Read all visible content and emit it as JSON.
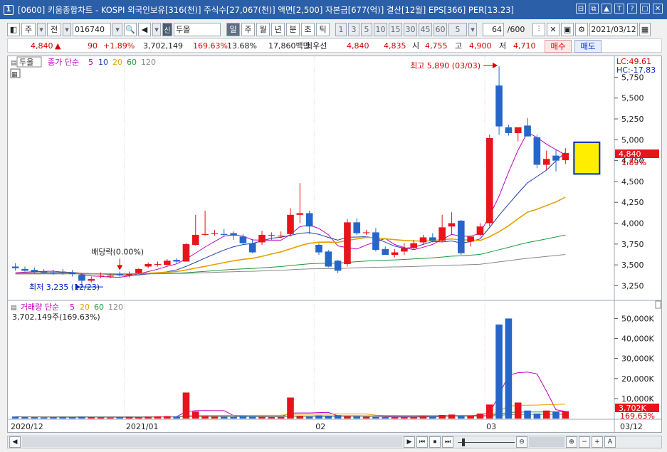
{
  "window": {
    "title": "[0600] 키움종합차트 - KOSPI 외국인보유[316(천)] 주식수[27,067(천)] 액면[2,500] 자본금[677(억)] 결산[12월] EPS[366] PER[13.23]",
    "badge": "1",
    "controls": [
      "⊟",
      "⧉",
      "▲",
      "T",
      "?",
      "▢",
      "✕"
    ]
  },
  "toolbar": {
    "period_type": "주",
    "market_btn": "전",
    "code": "016740",
    "stock_mark": "신",
    "stock_name": "두올",
    "periods": [
      "일",
      "주",
      "월",
      "년",
      "분",
      "초",
      "틱"
    ],
    "active_period": "일",
    "minute_options": [
      "1",
      "3",
      "5",
      "10",
      "15",
      "30",
      "45",
      "60"
    ],
    "tick_value": "5",
    "count": "64",
    "count_total": "/600",
    "date": "2021/03/12"
  },
  "quote": {
    "price": "4,840",
    "arrow": "▲",
    "change": "90",
    "change_pct": "+1.89%",
    "volume": "3,702,149",
    "volume_ratio": "169.63%",
    "turnover": "13.68%",
    "amount": "17,860백만",
    "best_bid_label": "최우선",
    "best_ask": "4,840",
    "best_bid": "4,835",
    "open_label": "시",
    "open": "4,755",
    "high_label": "고",
    "high": "4,900",
    "low_label": "저",
    "low": "4,710",
    "buy_label": "매수",
    "sell_label": "매도"
  },
  "price_panel": {
    "stock_label": "두올",
    "legend_prefix": "종가 단순",
    "ma": [
      {
        "label": "5",
        "color": "#c000c0"
      },
      {
        "label": "10",
        "color": "#1f3ea6"
      },
      {
        "label": "20",
        "color": "#e3a100"
      },
      {
        "label": "60",
        "color": "#1e9a3a"
      },
      {
        "label": "120",
        "color": "#888888"
      }
    ],
    "lc": "LC:49.61",
    "hc": "HC:-17.83",
    "y_ticks": [
      "5,750",
      "5,500",
      "5,250",
      "5,000",
      "4,750",
      "4,500",
      "4,250",
      "4,000",
      "3,750",
      "3,500",
      "3,250"
    ],
    "current_price_tag": "4,840",
    "current_pct_tag": "1.89%",
    "high_annotation": "최고 5,890 (03/03)",
    "low_annotation": "최저 3,235 (12/23)",
    "dividend_annotation": "배당락(0.00%)"
  },
  "volume_panel": {
    "legend_prefix": "거래량 단순",
    "ma": [
      {
        "label": "5",
        "color": "#c000c0"
      },
      {
        "label": "20",
        "color": "#e3a100"
      },
      {
        "label": "60",
        "color": "#1e9a3a"
      },
      {
        "label": "120",
        "color": "#888888"
      }
    ],
    "current_volume_text": "3,702,149주(169.63%)",
    "y_ticks": [
      "50,000K",
      "40,000K",
      "30,000K",
      "20,000K",
      "10,000K"
    ],
    "current_volume_tag": "3,702K",
    "current_volume_pct_tag": "169.63%"
  },
  "x_axis": {
    "labels": [
      "2020/12",
      "2021/01",
      "02",
      "03"
    ],
    "cursor_date": "03/12"
  },
  "scroll": {
    "buttons": [
      "◀",
      "▶",
      "⏮",
      "⏹",
      "⏭",
      "⊖",
      "⊕",
      "−",
      "+",
      "A"
    ]
  },
  "colors": {
    "up_candle": "#e8141b",
    "down_candle": "#2566c8",
    "title_bar": "#2b5fa7",
    "highlight_box": "#ffee00"
  },
  "chart_data": {
    "type": "candlestick",
    "dates": [
      "12/14",
      "12/15",
      "12/16",
      "12/17",
      "12/18",
      "12/21",
      "12/22",
      "12/23",
      "12/24",
      "12/28",
      "12/29",
      "12/30",
      "01/04",
      "01/05",
      "01/06",
      "01/07",
      "01/08",
      "01/11",
      "01/12",
      "01/13",
      "01/14",
      "01/15",
      "01/18",
      "01/19",
      "01/20",
      "01/21",
      "01/22",
      "01/25",
      "01/26",
      "01/27",
      "01/28",
      "01/29",
      "02/01",
      "02/02",
      "02/03",
      "02/04",
      "02/05",
      "02/08",
      "02/09",
      "02/10",
      "02/15",
      "02/16",
      "02/17",
      "02/18",
      "02/19",
      "02/22",
      "02/23",
      "02/24",
      "02/25",
      "02/26",
      "03/02",
      "03/03",
      "03/04",
      "03/05",
      "03/08",
      "03/09",
      "03/10",
      "03/11",
      "03/12"
    ],
    "open": [
      3480,
      3450,
      3440,
      3420,
      3410,
      3420,
      3410,
      3380,
      3310,
      3370,
      3360,
      3390,
      3380,
      3400,
      3480,
      3510,
      3500,
      3560,
      3540,
      3740,
      3860,
      3870,
      3870,
      3880,
      3840,
      3760,
      3770,
      3860,
      3840,
      3870,
      4100,
      4120,
      3740,
      3660,
      3550,
      3510,
      4010,
      3880,
      3890,
      3690,
      3620,
      3660,
      3700,
      3770,
      3830,
      3790,
      3960,
      4030,
      3780,
      3860,
      4000,
      5650,
      5150,
      5080,
      5170,
      5030,
      4700,
      4810,
      4755
    ],
    "high": [
      3520,
      3480,
      3470,
      3450,
      3440,
      3450,
      3440,
      3400,
      3360,
      3410,
      3400,
      3420,
      3420,
      3460,
      3530,
      3540,
      3570,
      3580,
      3760,
      4100,
      4150,
      3920,
      3930,
      3900,
      3870,
      3810,
      3910,
      3890,
      3900,
      4180,
      4480,
      4150,
      3760,
      3680,
      3560,
      4050,
      4060,
      3920,
      3940,
      3720,
      3690,
      3760,
      3800,
      3860,
      3880,
      4100,
      4130,
      4040,
      3800,
      4000,
      5060,
      5880,
      5180,
      5100,
      5260,
      5060,
      4870,
      4880,
      4900
    ],
    "low": [
      3430,
      3420,
      3400,
      3390,
      3380,
      3380,
      3360,
      3235,
      3290,
      3340,
      3340,
      3360,
      3350,
      3390,
      3460,
      3480,
      3490,
      3520,
      3540,
      3730,
      3850,
      3850,
      3840,
      3800,
      3740,
      3640,
      3740,
      3800,
      3820,
      3840,
      4000,
      3870,
      3620,
      3470,
      3400,
      3480,
      3860,
      3860,
      3660,
      3640,
      3590,
      3620,
      3680,
      3740,
      3770,
      3770,
      3860,
      3620,
      3720,
      3840,
      3960,
      5060,
      5050,
      4980,
      5120,
      4660,
      4640,
      4620,
      4710
    ],
    "close": [
      3460,
      3430,
      3420,
      3410,
      3400,
      3410,
      3390,
      3310,
      3330,
      3370,
      3370,
      3380,
      3390,
      3450,
      3510,
      3510,
      3550,
      3540,
      3750,
      3860,
      3870,
      3880,
      3860,
      3850,
      3760,
      3650,
      3860,
      3860,
      3850,
      4100,
      4120,
      3960,
      3650,
      3480,
      3430,
      4010,
      3880,
      3890,
      3680,
      3620,
      3650,
      3700,
      3760,
      3830,
      3790,
      3950,
      4000,
      3640,
      3840,
      3960,
      5020,
      5160,
      5080,
      5150,
      5040,
      4700,
      4770,
      4750,
      4840
    ],
    "volume_K": [
      1000,
      800,
      700,
      600,
      700,
      800,
      600,
      900,
      700,
      600,
      500,
      700,
      800,
      700,
      900,
      1100,
      1200,
      1000,
      13000,
      3500,
      1300,
      1000,
      900,
      800,
      1200,
      1000,
      900,
      700,
      800,
      10500,
      1200,
      900,
      1600,
      1300,
      1700,
      1100,
      1000,
      900,
      800,
      700,
      700,
      700,
      800,
      1100,
      1000,
      1800,
      2000,
      1200,
      1400,
      2500,
      7000,
      47000,
      50000,
      8000,
      4000,
      2500,
      4000,
      3500,
      3702
    ],
    "ylim_price": [
      3100,
      5950
    ],
    "ylim_volume": [
      0,
      53000
    ],
    "high_point": {
      "date": "03/03",
      "value": 5890
    },
    "low_point": {
      "date": "12/23",
      "value": 3235
    }
  }
}
